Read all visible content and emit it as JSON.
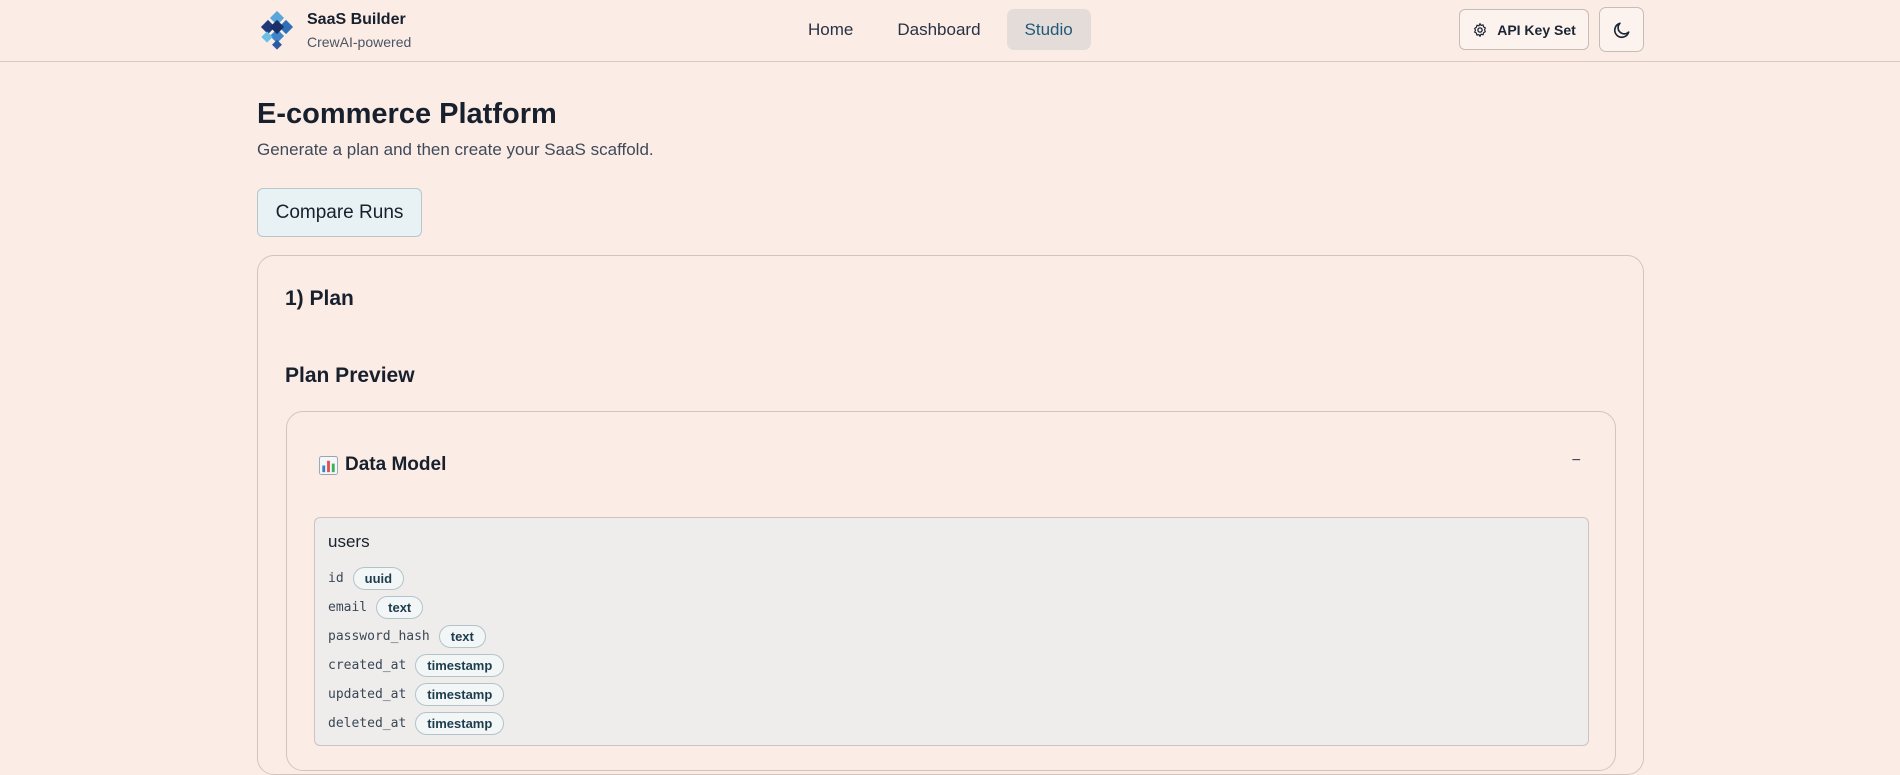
{
  "app": {
    "name": "SaaS Builder",
    "subtitle": "CrewAI-powered"
  },
  "nav": {
    "items": [
      {
        "label": "Home",
        "active": false
      },
      {
        "label": "Dashboard",
        "active": false
      },
      {
        "label": "Studio",
        "active": true
      }
    ]
  },
  "header_actions": {
    "api_key_label": "API Key Set",
    "api_key_icon": "gear-icon",
    "theme_icon": "moon-icon"
  },
  "page": {
    "title": "E-commerce Platform",
    "subtitle": "Generate a plan and then create your SaaS scaffold.",
    "compare_label": "Compare Runs"
  },
  "plan": {
    "section_title": "1) Plan",
    "preview_title": "Plan Preview",
    "data_model": {
      "icon": "bar-chart-emoji",
      "title": "Data Model",
      "toggle": "−",
      "table": {
        "name": "users",
        "fields": [
          {
            "name": "id",
            "type": "uuid"
          },
          {
            "name": "email",
            "type": "text"
          },
          {
            "name": "password_hash",
            "type": "text"
          },
          {
            "name": "created_at",
            "type": "timestamp"
          },
          {
            "name": "updated_at",
            "type": "timestamp"
          },
          {
            "name": "deleted_at",
            "type": "timestamp"
          }
        ]
      }
    }
  },
  "colors": {
    "background": "#fcece6",
    "nav_active_bg": "#e4dcd8",
    "nav_active_text": "#1f5a7a",
    "compare_bg": "#e8f1f3",
    "table_bg": "#eeedec"
  }
}
